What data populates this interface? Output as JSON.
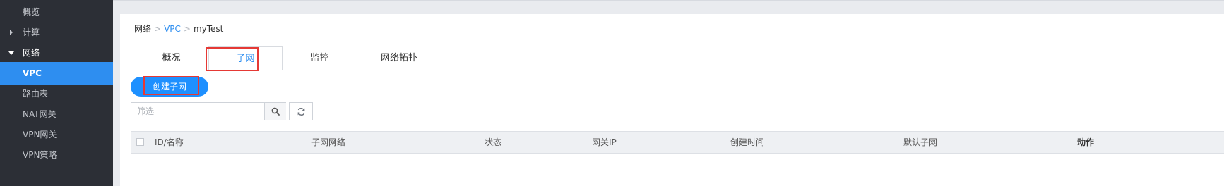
{
  "sidebar": {
    "items": [
      {
        "label": "概览",
        "type": "item"
      },
      {
        "label": "计算",
        "type": "group-collapsed"
      },
      {
        "label": "网络",
        "type": "group-expanded"
      },
      {
        "label": "VPC",
        "type": "active"
      },
      {
        "label": "路由表",
        "type": "item"
      },
      {
        "label": "NAT网关",
        "type": "item"
      },
      {
        "label": "VPN网关",
        "type": "item"
      },
      {
        "label": "VPN策略",
        "type": "item"
      }
    ]
  },
  "breadcrumb": {
    "root": "网络",
    "separator": ">",
    "section": "VPC",
    "current": "myTest"
  },
  "tabs": [
    {
      "label": "概况",
      "active": false
    },
    {
      "label": "子网",
      "active": true
    },
    {
      "label": "监控",
      "active": false
    },
    {
      "label": "网络拓扑",
      "active": false
    }
  ],
  "toolbar": {
    "create_label": "创建子网",
    "filter_placeholder": "筛选",
    "search_icon": "search-icon",
    "refresh_icon": "refresh-icon"
  },
  "table": {
    "columns": [
      "ID/名称",
      "子网网络",
      "状态",
      "网关IP",
      "创建时间",
      "默认子网",
      "动作"
    ]
  },
  "colors": {
    "accent": "#2e8ef0",
    "sidebar_bg": "#2c2f36",
    "highlight": "#e53935"
  }
}
